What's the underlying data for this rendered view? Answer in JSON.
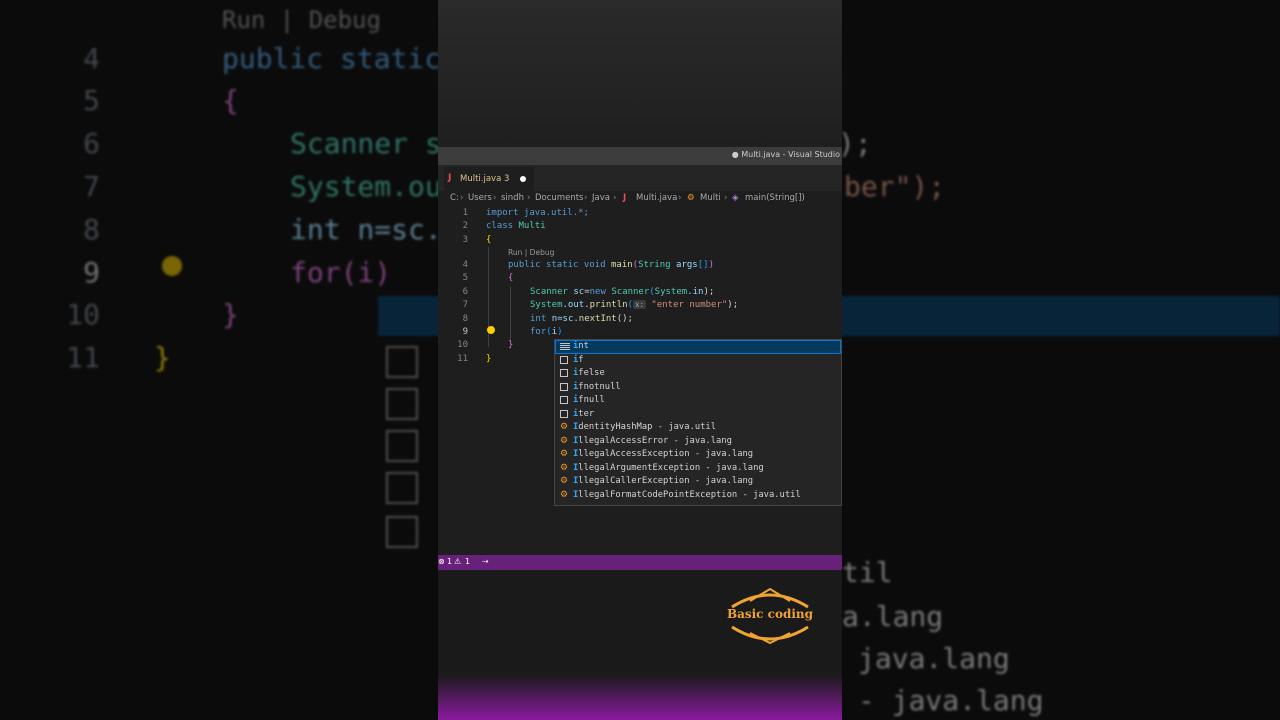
{
  "window": {
    "title": "● Multi.java - Visual Studio"
  },
  "tab": {
    "icon": "java-icon",
    "label": "Multi.java 3"
  },
  "breadcrumb": {
    "items": [
      "C:",
      "Users",
      "sindh",
      "Documents",
      "Java",
      "Multi.java",
      "Multi",
      "main(String[])"
    ]
  },
  "editor": {
    "line_numbers": [
      "1",
      "2",
      "3",
      "4",
      "5",
      "6",
      "7",
      "8",
      "9",
      "10",
      "11"
    ],
    "codelens": "Run | Debug",
    "inlay_hint": "x:",
    "lines": {
      "l1": "import java.util.*;",
      "l2_kw": "class",
      "l2_name": "Multi",
      "l3": "{",
      "l4_pub": "public",
      "l4_static": "static",
      "l4_void": "void",
      "l4_main": "main",
      "l4_open": "(",
      "l4_type": "String",
      "l4_args": "args",
      "l4_arr": "[]",
      "l4_close": ")",
      "l5": "{",
      "l6_type": "Scanner",
      "l6_var": "sc",
      "l6_eq": "=",
      "l6_new": "new",
      "l6_type2": "Scanner",
      "l6_open": "(",
      "l6_sys": "System",
      "l6_in": ".in",
      "l6_close": ");",
      "l7_sys": "System",
      "l7_out": ".out.",
      "l7_fn": "println",
      "l7_open": "(",
      "l7_str": "\"enter number\"",
      "l7_close": ");",
      "l8_kw": "int",
      "l8_rest": "n=sc.",
      "l8_fn": "nextInt",
      "l8_end": "();",
      "l9_kw": "for",
      "l9_open": "(",
      "l9_var": "i",
      "l9_close": ")",
      "l10": "}",
      "l11": "}"
    }
  },
  "suggestions": {
    "match": "i",
    "items": [
      {
        "icon": "keyword-icon",
        "rest": "nt",
        "suffix": ""
      },
      {
        "icon": "snippet-icon",
        "rest": "f",
        "suffix": ""
      },
      {
        "icon": "snippet-icon",
        "rest": "felse",
        "suffix": ""
      },
      {
        "icon": "snippet-icon",
        "rest": "fnotnull",
        "suffix": ""
      },
      {
        "icon": "snippet-icon",
        "rest": "fnull",
        "suffix": ""
      },
      {
        "icon": "snippet-icon",
        "rest": "ter",
        "suffix": ""
      },
      {
        "icon": "class-icon",
        "rest": "dentityHashMap",
        "suffix": " - java.util"
      },
      {
        "icon": "class-icon",
        "rest": "llegalAccessError",
        "suffix": " - java.lang"
      },
      {
        "icon": "class-icon",
        "rest": "llegalAccessException",
        "suffix": " - java.lang"
      },
      {
        "icon": "class-icon",
        "rest": "llegalArgumentException",
        "suffix": " - java.lang"
      },
      {
        "icon": "class-icon",
        "rest": "llegalCallerException",
        "suffix": " - java.lang"
      },
      {
        "icon": "class-icon",
        "rest": "llegalFormatCodePointException",
        "suffix": " - java.util"
      }
    ]
  },
  "statusbar": {
    "errors": "1",
    "warnings": "1"
  },
  "watermark": {
    "text": "Basic coding"
  },
  "background": {
    "codelens": "Run | Debug",
    "nums": [
      "4",
      "5",
      "6",
      "7",
      "8",
      "9",
      "10",
      "11"
    ],
    "l4": "public static",
    "l6": "Scanner s",
    "l7": "System.ou",
    "l8": "int n=sc.",
    "l9": "for(i)",
    "r_l6": ");",
    "r_l7": "ber\");",
    "r1": "til",
    "r2": "a.lang",
    "r3": "java.lang",
    "r4": "- java.lang"
  },
  "colors": {
    "statusbar": "#68217a",
    "accent": "#0078d4",
    "selection": "#04395e"
  }
}
